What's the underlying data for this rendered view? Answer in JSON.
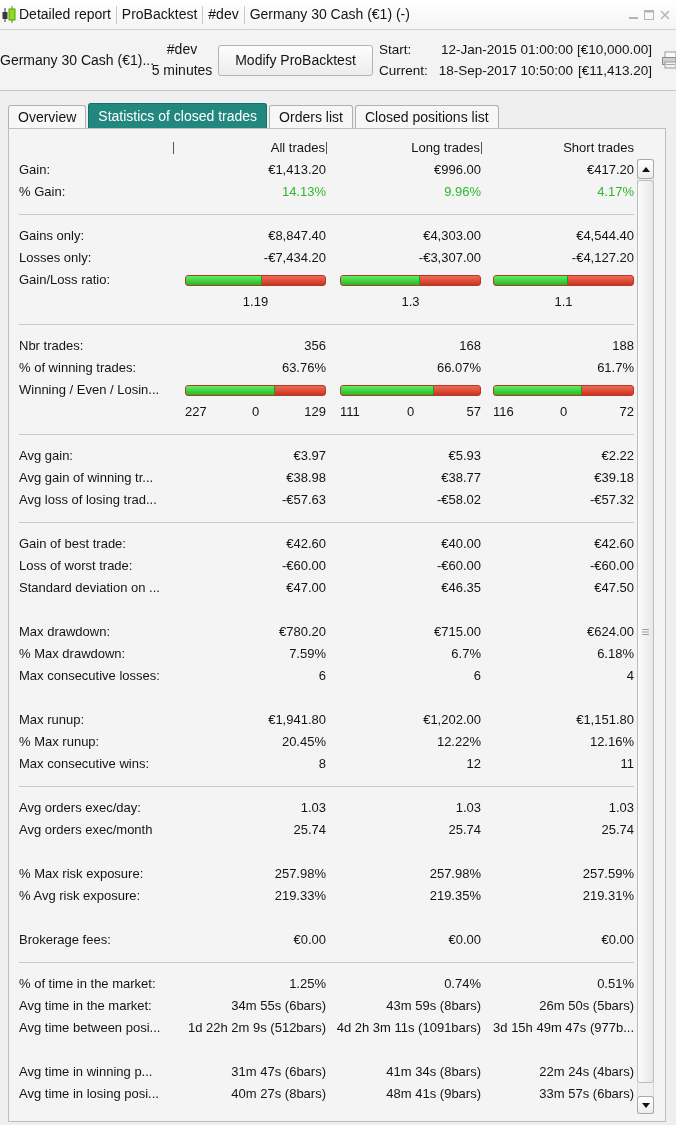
{
  "window": {
    "title_parts": [
      "Detailed report",
      "ProBacktest",
      "#dev",
      "Germany 30 Cash (€1) (-)"
    ]
  },
  "header": {
    "instrument": "Germany 30 Cash (€1)...",
    "system": "#dev",
    "timeframe": "5 minutes",
    "button": "Modify ProBacktest",
    "period": [
      {
        "label": "Start:",
        "datetime": "12-Jan-2015 01:00:00",
        "capital": "[€10,000.00]"
      },
      {
        "label": "Current:",
        "datetime": "18-Sep-2017 10:50:00",
        "capital": "[€11,413.20]"
      }
    ]
  },
  "tabs": [
    {
      "label": "Overview",
      "selected": false
    },
    {
      "label": "Statistics of closed trades",
      "selected": true
    },
    {
      "label": "Orders list",
      "selected": false
    },
    {
      "label": "Closed positions list",
      "selected": false
    }
  ],
  "table": {
    "columns": [
      "All trades",
      "Long trades",
      "Short trades"
    ],
    "groups": [
      {
        "rule": false,
        "rows": [
          {
            "kind": "values",
            "label": "Gain:",
            "values": [
              "€1,413.20",
              "€996.00",
              "€417.20"
            ]
          },
          {
            "kind": "values",
            "label": "% Gain:",
            "values": [
              "14.13%",
              "9.96%",
              "4.17%"
            ],
            "color": "#2db82d"
          }
        ]
      },
      {
        "rule": true,
        "rows": [
          {
            "kind": "values",
            "label": "Gains only:",
            "values": [
              "€8,847.40",
              "€4,303.00",
              "€4,544.40"
            ]
          },
          {
            "kind": "values",
            "label": "Losses only:",
            "values": [
              "-€7,434.20",
              "-€3,307.00",
              "-€4,127.20"
            ]
          },
          {
            "kind": "ratio_bar",
            "label": "Gain/Loss ratio:",
            "bars": [
              {
                "level": 0.55,
                "caption": "1.19"
              },
              {
                "level": 0.57,
                "caption": "1.3"
              },
              {
                "level": 0.53,
                "caption": "1.1"
              }
            ]
          }
        ]
      },
      {
        "rule": true,
        "rows": [
          {
            "kind": "values",
            "label": "Nbr trades:",
            "values": [
              "356",
              "168",
              "188"
            ]
          },
          {
            "kind": "values",
            "label": "% of winning trades:",
            "values": [
              "63.76%",
              "66.07%",
              "61.7%"
            ]
          },
          {
            "kind": "count_bar",
            "label": "Winning / Even / Losin...",
            "bars": [
              {
                "level": 0.64,
                "counts": [
                  "227",
                  "0",
                  "129"
                ]
              },
              {
                "level": 0.67,
                "counts": [
                  "111",
                  "0",
                  "57"
                ]
              },
              {
                "level": 0.63,
                "counts": [
                  "116",
                  "0",
                  "72"
                ]
              }
            ]
          }
        ]
      },
      {
        "rule": true,
        "rows": [
          {
            "kind": "values",
            "label": "Avg gain:",
            "values": [
              "€3.97",
              "€5.93",
              "€2.22"
            ]
          },
          {
            "kind": "values",
            "label": "Avg gain of winning tr...",
            "values": [
              "€38.98",
              "€38.77",
              "€39.18"
            ]
          },
          {
            "kind": "values",
            "label": "Avg loss of losing trad...",
            "values": [
              "-€57.63",
              "-€58.02",
              "-€57.32"
            ]
          }
        ]
      },
      {
        "rule": true,
        "rows": [
          {
            "kind": "values",
            "label": "Gain of best trade:",
            "values": [
              "€42.60",
              "€40.00",
              "€42.60"
            ]
          },
          {
            "kind": "values",
            "label": "Loss of worst trade:",
            "values": [
              "-€60.00",
              "-€60.00",
              "-€60.00"
            ]
          },
          {
            "kind": "values",
            "label": "Standard deviation on ...",
            "values": [
              "€47.00",
              "€46.35",
              "€47.50"
            ]
          }
        ]
      },
      {
        "rule": false,
        "rows": [
          {
            "kind": "values",
            "label": "Max drawdown:",
            "values": [
              "€780.20",
              "€715.00",
              "€624.00"
            ]
          },
          {
            "kind": "values",
            "label": "% Max drawdown:",
            "values": [
              "7.59%",
              "6.7%",
              "6.18%"
            ]
          },
          {
            "kind": "values",
            "label": "Max consecutive losses:",
            "values": [
              "6",
              "6",
              "4"
            ]
          }
        ]
      },
      {
        "rule": false,
        "rows": [
          {
            "kind": "values",
            "label": "Max runup:",
            "values": [
              "€1,941.80",
              "€1,202.00",
              "€1,151.80"
            ]
          },
          {
            "kind": "values",
            "label": "% Max runup:",
            "values": [
              "20.45%",
              "12.22%",
              "12.16%"
            ]
          },
          {
            "kind": "values",
            "label": "Max consecutive wins:",
            "values": [
              "8",
              "12",
              "11"
            ]
          }
        ]
      },
      {
        "rule": true,
        "rows": [
          {
            "kind": "values",
            "label": "Avg orders exec/day:",
            "values": [
              "1.03",
              "1.03",
              "1.03"
            ]
          },
          {
            "kind": "values",
            "label": "Avg orders exec/month",
            "values": [
              "25.74",
              "25.74",
              "25.74"
            ]
          }
        ]
      },
      {
        "rule": false,
        "rows": [
          {
            "kind": "values",
            "label": "% Max risk exposure:",
            "values": [
              "257.98%",
              "257.98%",
              "257.59%"
            ]
          },
          {
            "kind": "values",
            "label": "% Avg risk exposure:",
            "values": [
              "219.33%",
              "219.35%",
              "219.31%"
            ]
          }
        ]
      },
      {
        "rule": false,
        "rows": [
          {
            "kind": "values",
            "label": "Brokerage fees:",
            "values": [
              "€0.00",
              "€0.00",
              "€0.00"
            ]
          }
        ]
      },
      {
        "rule": true,
        "rows": [
          {
            "kind": "values",
            "label": "% of time in the market:",
            "values": [
              "1.25%",
              "0.74%",
              "0.51%"
            ]
          },
          {
            "kind": "values",
            "label": "Avg time in the market:",
            "values": [
              "34m 55s (6bars)",
              "43m 59s (8bars)",
              "26m 50s (5bars)"
            ]
          },
          {
            "kind": "values",
            "label": "Avg time between posi...",
            "values": [
              "1d 22h 2m 9s (512bars)",
              "4d 2h 3m 11s (1091bars)",
              "3d 15h 49m 47s (977b..."
            ]
          }
        ]
      },
      {
        "rule": false,
        "rows": [
          {
            "kind": "values",
            "label": "Avg time in winning p...",
            "values": [
              "31m 47s (6bars)",
              "41m 34s (8bars)",
              "22m 24s (4bars)"
            ]
          },
          {
            "kind": "values",
            "label": "Avg time in losing posi...",
            "values": [
              "40m 27s (8bars)",
              "48m 41s (9bars)",
              "33m 57s (6bars)"
            ]
          }
        ]
      }
    ]
  }
}
